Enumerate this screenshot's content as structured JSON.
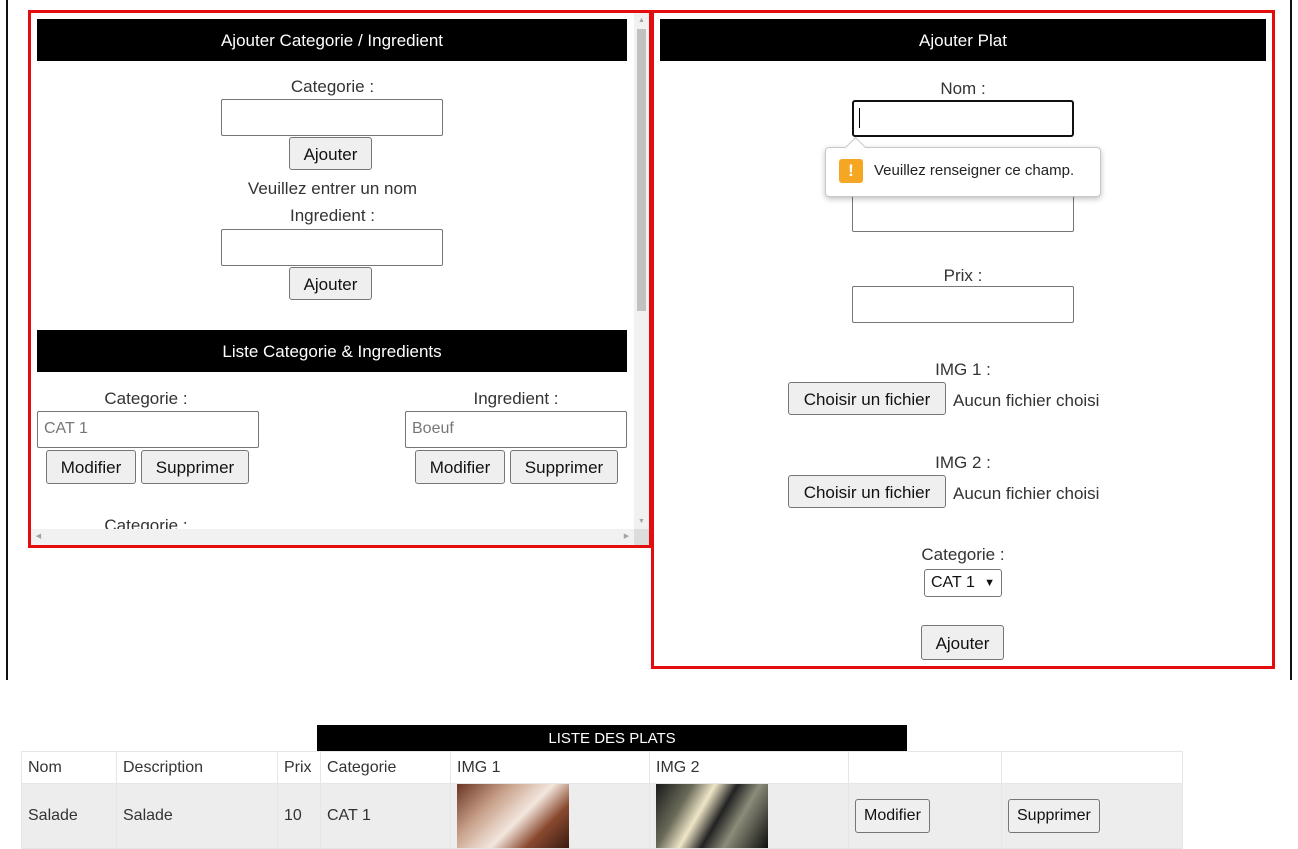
{
  "left_panel": {
    "add_section": {
      "title": "Ajouter Categorie / Ingredient",
      "categorie_label": "Categorie :",
      "categorie_value": "",
      "categorie_button": "Ajouter",
      "categorie_message": "Veuillez entrer un nom",
      "ingredient_label": "Ingredient :",
      "ingredient_value": "",
      "ingredient_button": "Ajouter"
    },
    "list_section": {
      "title": "Liste Categorie & Ingredients",
      "categorie_label": "Categorie :",
      "categorie_value": "CAT 1",
      "ingredient_label": "Ingredient :",
      "ingredient_value": "Boeuf",
      "modify_label": "Modifier",
      "delete_label": "Supprimer",
      "next_categorie_label": "Categorie :"
    }
  },
  "right_panel": {
    "title": "Ajouter Plat",
    "nom_label": "Nom :",
    "nom_value": "",
    "tooltip": "Veuillez renseigner ce champ.",
    "prix_label": "Prix :",
    "img1_label": "IMG 1 :",
    "img2_label": "IMG 2 :",
    "file_button": "Choisir un fichier",
    "file_status": "Aucun fichier choisi",
    "categorie_label": "Categorie :",
    "categorie_selected": "CAT 1",
    "submit_label": "Ajouter"
  },
  "plats": {
    "title": "LISTE DES PLATS",
    "columns": [
      "Nom",
      "Description",
      "Prix",
      "Categorie",
      "IMG 1",
      "IMG 2",
      "",
      ""
    ],
    "rows": [
      {
        "nom": "Salade",
        "description": "Salade",
        "prix": "10",
        "categorie": "CAT 1",
        "modify": "Modifier",
        "delete": "Supprimer"
      }
    ]
  },
  "colors": {
    "panel_border": "#e30d0d",
    "header_bg": "#000000",
    "header_text": "#ffffff",
    "warning_icon": "#f5a623"
  },
  "icons": [
    "warning-icon",
    "chevron-down-icon",
    "scroll-up-icon",
    "scroll-down-icon",
    "scroll-left-icon",
    "scroll-right-icon"
  ]
}
